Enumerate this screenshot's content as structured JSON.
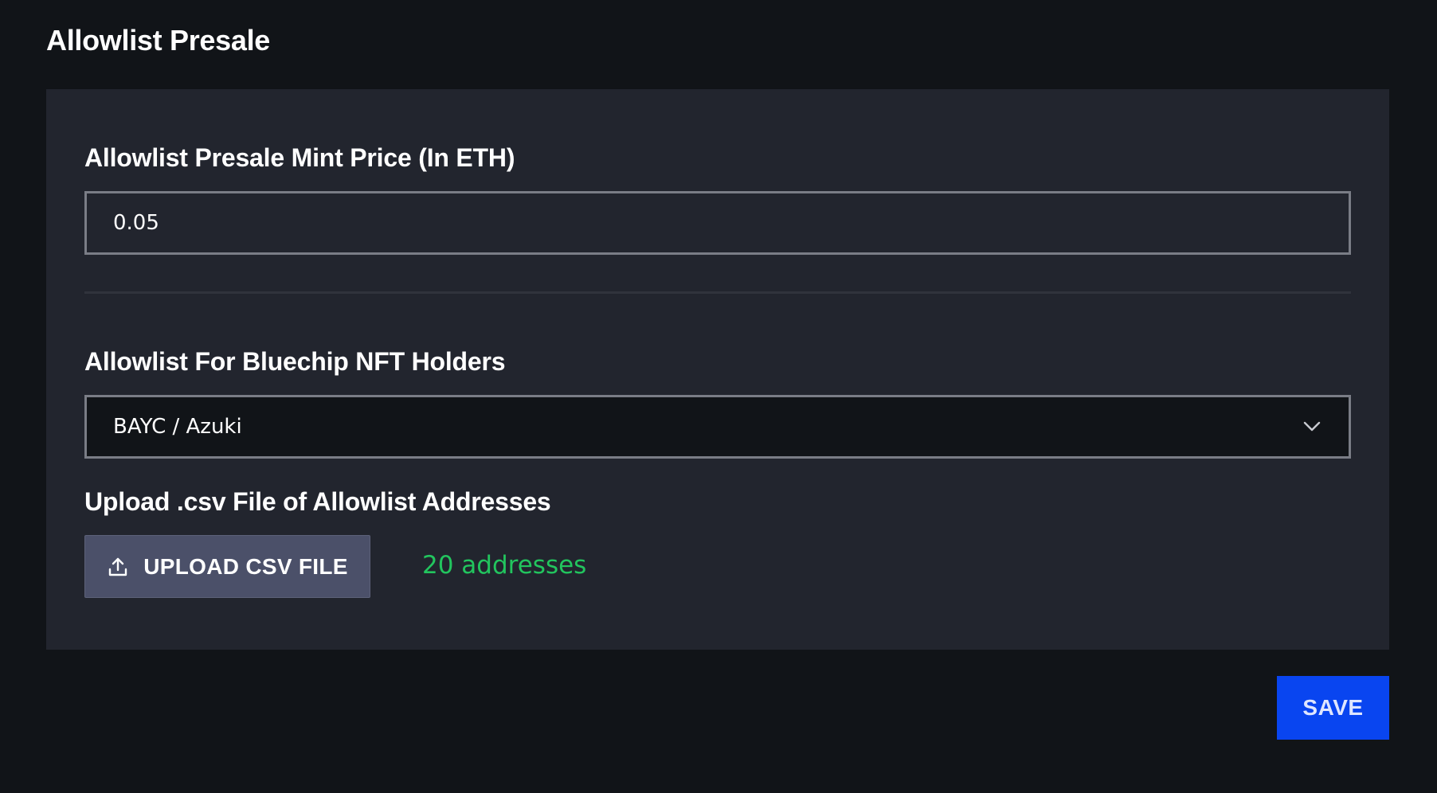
{
  "section": {
    "title": "Allowlist Presale"
  },
  "price_field": {
    "label": "Allowlist Presale Mint Price (In ETH)",
    "value": "0.05"
  },
  "bluechip_field": {
    "label": "Allowlist For Bluechip NFT Holders",
    "selected": "BAYC / Azuki",
    "icon": "chevron-down-icon"
  },
  "upload_field": {
    "label": "Upload .csv File of Allowlist Addresses",
    "button_label": "UPLOAD CSV FILE",
    "button_icon": "upload-icon",
    "status": "20 addresses",
    "status_color": "#22c55e"
  },
  "actions": {
    "save_label": "SAVE",
    "save_color": "#0945f0"
  }
}
